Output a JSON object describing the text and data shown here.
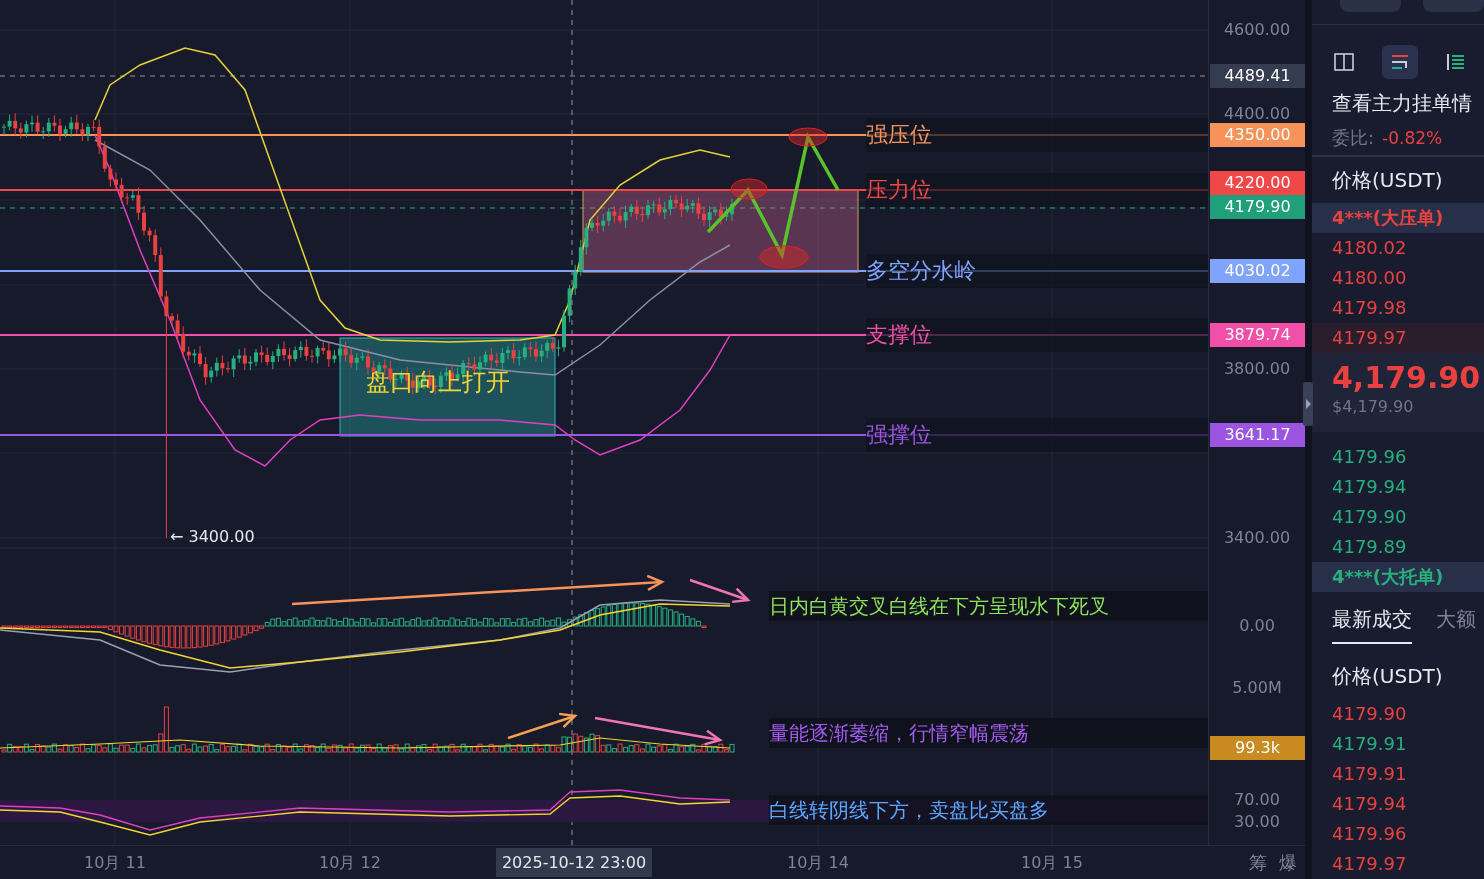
{
  "price_axis": {
    "ticks": [
      "4600.00",
      "4400.00",
      "3800.00",
      "3400.00"
    ]
  },
  "crosshair": {
    "price": "4489.41",
    "time": "2025-10-12 23:00"
  },
  "last_price_tag": "4179.90",
  "levels": [
    {
      "label": "强压位",
      "price": "4350.00",
      "color": "#f7935a"
    },
    {
      "label": "压力位",
      "price": "4220.00",
      "color": "#f04848"
    },
    {
      "label": "多空分水岭",
      "price": "4030.02",
      "color": "#7fa3ff"
    },
    {
      "label": "支撑位",
      "price": "3879.74",
      "color": "#f050a8"
    },
    {
      "label": "强撑位",
      "price": "3641.17",
      "color": "#9b55e0"
    }
  ],
  "range_box": {
    "label": "盘口向上打开"
  },
  "low_marker": "← 3400.00",
  "indicators": [
    {
      "note": "日内白黄交叉白线在下方呈现水下死叉",
      "color": "#8fe35a",
      "axis_labels": [
        "0.00"
      ]
    },
    {
      "note": "量能逐渐萎缩，行情窄幅震荡",
      "color": "#a35cf0",
      "axis_labels": [
        "5.00M"
      ],
      "tag": "99.3k"
    },
    {
      "note": "白线转阴线下方，卖盘比买盘多",
      "color": "#5aa8ff",
      "axis_labels": [
        "70.00",
        "30.00"
      ]
    }
  ],
  "time_axis": {
    "labels": [
      "10月 11",
      "10月 12",
      "10月 14",
      "10月 15"
    ],
    "buttons": [
      "筹",
      "爆"
    ]
  },
  "side": {
    "icon_tabs": [
      {
        "selected": false
      },
      {
        "selected": true
      },
      {
        "selected": false
      }
    ],
    "title": "查看主力挂单情",
    "ratio_label": "委比:",
    "ratio_value": "-0.82%",
    "book_header": "价格(USDT)",
    "asks": [
      {
        "price": "4***(大压单)",
        "kind": "big",
        "highlighted": false
      },
      {
        "price": "4180.02",
        "kind": "level",
        "highlighted": false
      },
      {
        "price": "4180.00",
        "kind": "level",
        "highlighted": false
      },
      {
        "price": "4179.98",
        "kind": "level",
        "highlighted": false
      },
      {
        "price": "4179.97",
        "kind": "level",
        "highlighted": true
      }
    ],
    "last_price": "4,179.90",
    "last_price_usd": "$4,179.90",
    "bids": [
      {
        "price": "4179.96",
        "kind": "level"
      },
      {
        "price": "4179.94",
        "kind": "level"
      },
      {
        "price": "4179.90",
        "kind": "level"
      },
      {
        "price": "4179.89",
        "kind": "level"
      },
      {
        "price": "4***(大托单)",
        "kind": "big"
      }
    ],
    "trade_tabs": [
      {
        "label": "最新成交",
        "selected": true
      },
      {
        "label": "大额",
        "selected": false
      }
    ],
    "trades_header": "价格(USDT)",
    "trades": [
      {
        "price": "4179.90",
        "color": "#e8413f"
      },
      {
        "price": "4179.91",
        "color": "#26b07e"
      },
      {
        "price": "4179.91",
        "color": "#e8413f"
      },
      {
        "price": "4179.94",
        "color": "#e8413f"
      },
      {
        "price": "4179.96",
        "color": "#e8413f"
      },
      {
        "price": "4179.97",
        "color": "#e8413f"
      }
    ]
  }
}
